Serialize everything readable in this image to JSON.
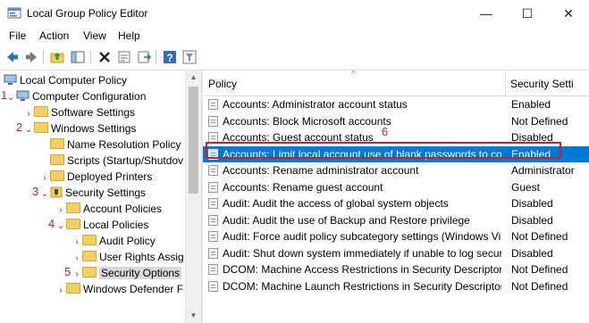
{
  "window": {
    "title": "Local Group Policy Editor",
    "min": "—",
    "max": "☐",
    "close": "✕"
  },
  "menu": [
    "File",
    "Action",
    "View",
    "Help"
  ],
  "toolbar": {
    "icons": [
      "back-icon",
      "forward-icon",
      "up-folder-icon",
      "show-hide-tree-icon",
      "delete-icon",
      "properties-icon",
      "export-icon",
      "help-icon",
      "filter-icon"
    ]
  },
  "tree": [
    {
      "label": "Local Computer Policy",
      "icon": "pc"
    },
    {
      "label": "Computer Configuration",
      "icon": "pc",
      "step": "1"
    },
    {
      "label": "Software Settings",
      "icon": "folder"
    },
    {
      "label": "Windows Settings",
      "icon": "folder",
      "step": "2"
    },
    {
      "label": "Name Resolution Policy",
      "icon": "folder"
    },
    {
      "label": "Scripts (Startup/Shutdov",
      "icon": "folder"
    },
    {
      "label": "Deployed Printers",
      "icon": "folder"
    },
    {
      "label": "Security Settings",
      "icon": "shield",
      "step": "3"
    },
    {
      "label": "Account Policies",
      "icon": "folder"
    },
    {
      "label": "Local Policies",
      "icon": "folder",
      "step": "4"
    },
    {
      "label": "Audit Policy",
      "icon": "folder"
    },
    {
      "label": "User Rights Assig",
      "icon": "folder"
    },
    {
      "label": "Security Options",
      "icon": "folder",
      "step": "5"
    },
    {
      "label": "Windows Defender F",
      "icon": "folder"
    }
  ],
  "list": {
    "col_policy": "Policy",
    "col_setting": "Security Setti",
    "rows": [
      {
        "policy": "Accounts: Administrator account status",
        "setting": "Enabled"
      },
      {
        "policy": "Accounts: Block Microsoft accounts",
        "setting": "Not Defined"
      },
      {
        "policy": "Accounts: Guest account status",
        "setting": "Disabled"
      },
      {
        "policy": "Accounts: Limit local account use of blank passwords to co...",
        "setting": "Enabled"
      },
      {
        "policy": "Accounts: Rename administrator account",
        "setting": "Administrator"
      },
      {
        "policy": "Accounts: Rename guest account",
        "setting": "Guest"
      },
      {
        "policy": "Audit: Audit the access of global system objects",
        "setting": "Disabled"
      },
      {
        "policy": "Audit: Audit the use of Backup and Restore privilege",
        "setting": "Disabled"
      },
      {
        "policy": "Audit: Force audit policy subcategory settings (Windows Vis...",
        "setting": "Not Defined"
      },
      {
        "policy": "Audit: Shut down system immediately if unable to log secur...",
        "setting": "Disabled"
      },
      {
        "policy": "DCOM: Machine Access Restrictions in Security Descriptor D...",
        "setting": "Not Defined"
      },
      {
        "policy": "DCOM: Machine Launch Restrictions in Security Descriptor ...",
        "setting": "Not Defined"
      }
    ]
  },
  "step6": "6",
  "colors": {
    "accent": "#0078d7",
    "annotation": "#c8202a"
  }
}
